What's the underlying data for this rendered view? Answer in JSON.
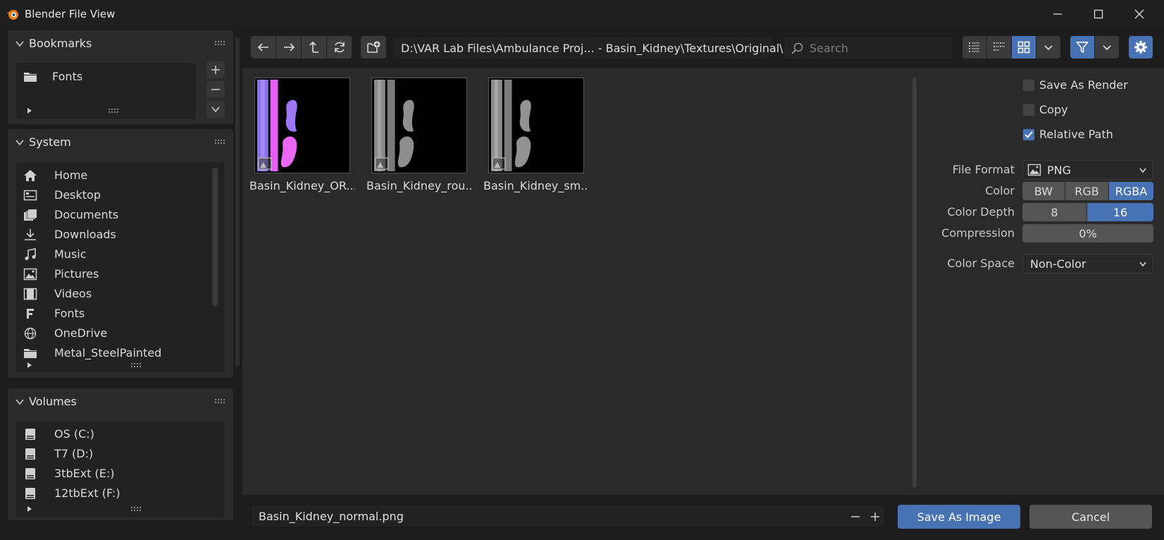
{
  "window": {
    "title": "Blender File View"
  },
  "bookmarks": {
    "title": "Bookmarks",
    "items": [
      {
        "label": "Fonts",
        "icon": "folder-icon"
      }
    ]
  },
  "system": {
    "title": "System",
    "items": [
      {
        "label": "Home",
        "icon": "home-icon"
      },
      {
        "label": "Desktop",
        "icon": "desktop-icon"
      },
      {
        "label": "Documents",
        "icon": "documents-icon"
      },
      {
        "label": "Downloads",
        "icon": "download-icon"
      },
      {
        "label": "Music",
        "icon": "music-icon"
      },
      {
        "label": "Pictures",
        "icon": "image-icon"
      },
      {
        "label": "Videos",
        "icon": "video-icon"
      },
      {
        "label": "Fonts",
        "icon": "font-icon"
      },
      {
        "label": "OneDrive",
        "icon": "globe-icon"
      },
      {
        "label": "Metal_SteelPainted",
        "icon": "folder-icon"
      }
    ]
  },
  "volumes": {
    "title": "Volumes",
    "items": [
      {
        "label": "OS (C:)",
        "icon": "drive-icon"
      },
      {
        "label": "T7 (D:)",
        "icon": "drive-icon"
      },
      {
        "label": "3tbExt (E:)",
        "icon": "drive-icon"
      },
      {
        "label": "12tbExt (F:)",
        "icon": "drive-icon"
      }
    ]
  },
  "toolbar": {
    "path": "D:\\VAR Lab Files\\Ambulance Proj... - Basin_Kidney\\Textures\\Original\\",
    "search_placeholder": "Search"
  },
  "files": [
    {
      "name": "Basin_Kidney_OR...",
      "style": "normal"
    },
    {
      "name": "Basin_Kidney_rou...",
      "style": "gray"
    },
    {
      "name": "Basin_Kidney_sm...",
      "style": "gray"
    }
  ],
  "settings": {
    "save_as_render": {
      "label": "Save As Render",
      "checked": false
    },
    "copy": {
      "label": "Copy",
      "checked": false
    },
    "relative_path": {
      "label": "Relative Path",
      "checked": true
    },
    "file_format": {
      "label": "File Format",
      "value": "PNG"
    },
    "color": {
      "label": "Color",
      "options": [
        "BW",
        "RGB",
        "RGBA"
      ],
      "selected": "RGBA"
    },
    "color_depth": {
      "label": "Color Depth",
      "options": [
        "8",
        "16"
      ],
      "selected": "16"
    },
    "compression": {
      "label": "Compression",
      "value": "0%",
      "fraction": 0
    },
    "color_space": {
      "label": "Color Space",
      "value": "Non-Color"
    }
  },
  "footer": {
    "filename": "Basin_Kidney_normal.png",
    "save_label": "Save As Image",
    "cancel_label": "Cancel"
  },
  "colors": {
    "accent": "#4772b3",
    "panel": "#2b2b2b",
    "background": "#1d1d1d"
  }
}
